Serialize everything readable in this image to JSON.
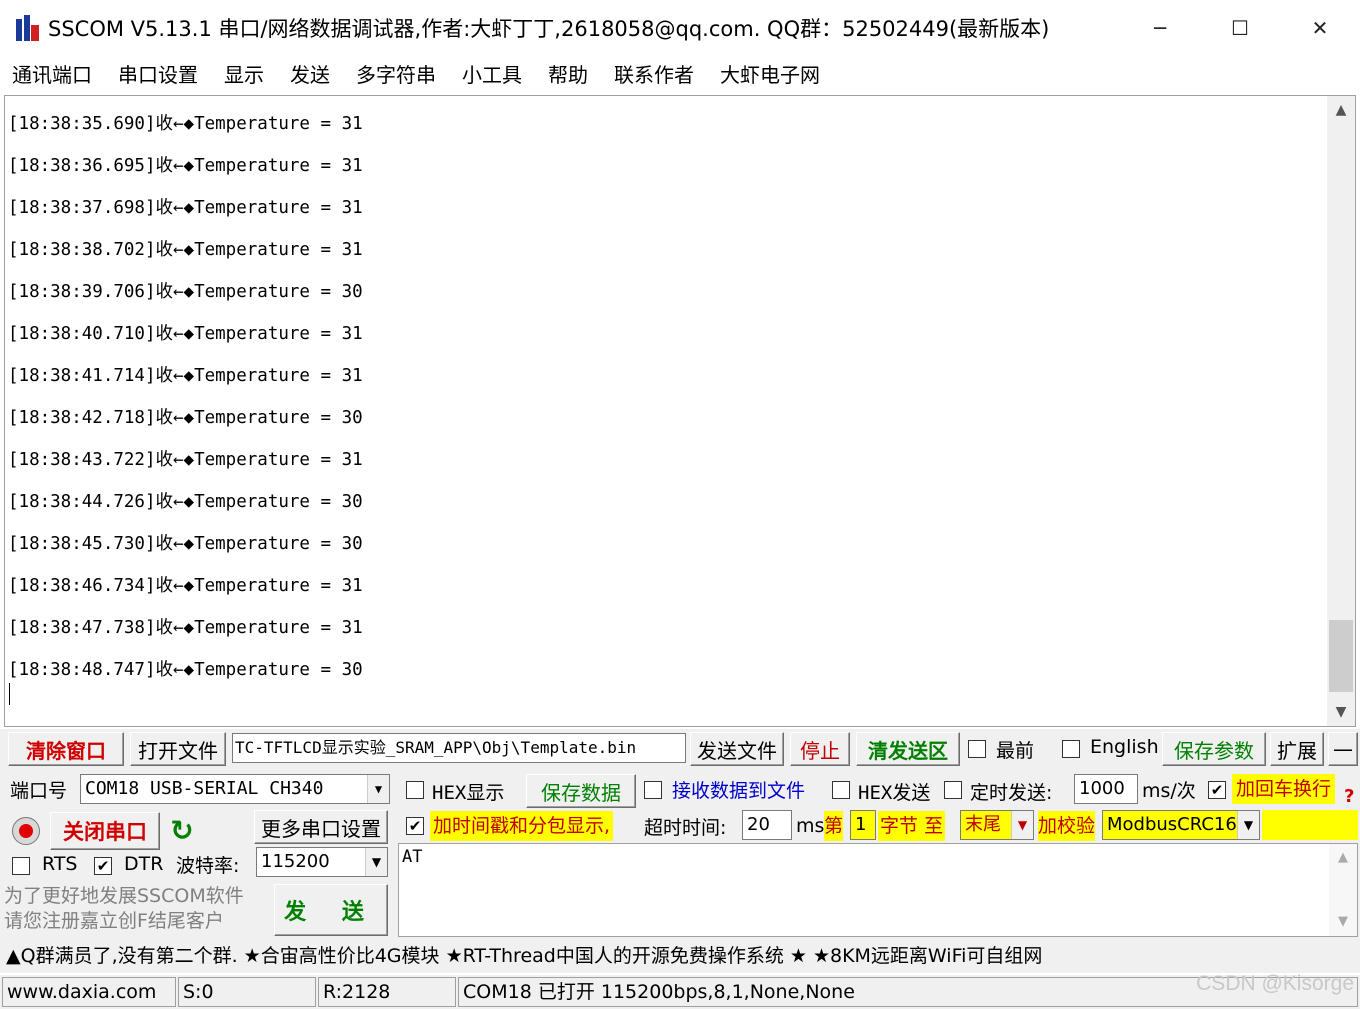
{
  "window": {
    "title": "SSCOM V5.13.1 串口/网络数据调试器,作者:大虾丁丁,2618058@qq.com. QQ群：52502449(最新版本)",
    "minimize_glyph": "─",
    "maximize_glyph": "☐",
    "close_glyph": "✕"
  },
  "menu": [
    "通讯端口",
    "串口设置",
    "显示",
    "发送",
    "多字符串",
    "小工具",
    "帮助",
    "联系作者",
    "大虾电子网"
  ],
  "receive": {
    "lines": [
      "[18:38:35.690]收←◆Temperature = 31",
      "[18:38:36.695]收←◆Temperature = 31",
      "[18:38:37.698]收←◆Temperature = 31",
      "[18:38:38.702]收←◆Temperature = 31",
      "[18:38:39.706]收←◆Temperature = 30",
      "[18:38:40.710]收←◆Temperature = 31",
      "[18:38:41.714]收←◆Temperature = 31",
      "[18:38:42.718]收←◆Temperature = 30",
      "[18:38:43.722]收←◆Temperature = 31",
      "[18:38:44.726]收←◆Temperature = 30",
      "[18:38:45.730]收←◆Temperature = 30",
      "[18:38:46.734]收←◆Temperature = 31",
      "[18:38:47.738]收←◆Temperature = 31",
      "[18:38:48.747]收←◆Temperature = 30"
    ]
  },
  "toolbar": {
    "clear_window": "清除窗口",
    "open_file": "打开文件",
    "file_path": "TC-TFTLCD显示实验_SRAM_APP\\Obj\\Template.bin",
    "send_file": "发送文件",
    "stop": "停止",
    "clear_send": "清发送区",
    "topmost": "最前",
    "english": "English",
    "save_params": "保存参数",
    "expand": "扩展",
    "collapse": "—"
  },
  "port": {
    "port_label": "端口号",
    "port_value": "COM18 USB-SERIAL CH340",
    "close_port": "关闭串口",
    "more_settings": "更多串口设置",
    "rts": "RTS",
    "dtr": "DTR",
    "baud_label": "波特率:",
    "baud_value": "115200",
    "promo": "为了更好地发展SSCOM软件\n请您注册嘉立创F结尾客户",
    "send": "发 送"
  },
  "options": {
    "hex_display": "HEX显示",
    "save_data": "保存数据",
    "recv_to_file": "接收数据到文件",
    "hex_send": "HEX发送",
    "timed_send": "定时发送:",
    "interval_value": "1000",
    "interval_unit": "ms/次",
    "add_crlf": "加回车换行",
    "timestamp": "加时间戳和分包显示,",
    "timeout_label": "超时时间:",
    "timeout_value": "20",
    "timeout_unit": "ms",
    "nth": "第",
    "byte_from": "1",
    "byte_label": "字节",
    "to": "至",
    "byte_to": "末尾",
    "checksum_label": "加校验",
    "checksum_value": "ModbusCRC16",
    "help_mark": "?"
  },
  "send_text": "AT",
  "ticker": "▲Q群满员了,没有第二个群. ★合宙高性价比4G模块 ★RT-Thread中国人的开源免费操作系统 ★ ★8KM远距离WiFi可自组网",
  "status": {
    "site": "www.daxia.com",
    "sent": "S:0",
    "received": "R:2128",
    "port_state": "COM18 已打开  115200bps,8,1,None,None"
  },
  "watermark": "CSDN @Kisorge",
  "colors": {
    "accent_red": "#d00000",
    "accent_green": "#008000",
    "highlight_yellow": "#ffff00"
  }
}
